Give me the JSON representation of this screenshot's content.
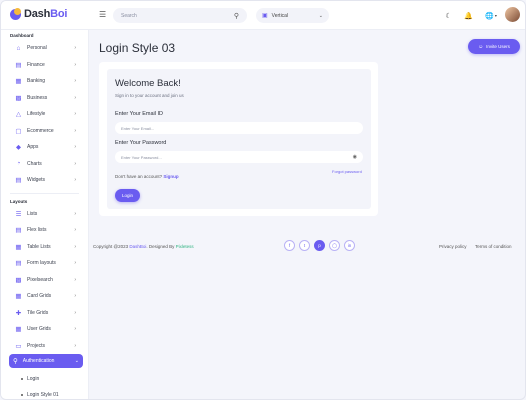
{
  "app": {
    "logo_prefix": "Dash",
    "logo_suffix": "Boi",
    "accent_color": "#6a5cf0"
  },
  "topbar": {
    "menu_icon": "hamburger-icon",
    "search_placeholder": "Search",
    "layout_value": "Vertical",
    "icons": [
      "moon-icon",
      "bell-icon",
      "globe-icon"
    ]
  },
  "sidebar": {
    "section_dashboard": "Dashboard",
    "dashboard_items": [
      {
        "label": "Personal",
        "icon": "home-icon"
      },
      {
        "label": "Finance",
        "icon": "finance-icon"
      },
      {
        "label": "Banking",
        "icon": "bank-icon"
      },
      {
        "label": "Business",
        "icon": "briefcase-icon"
      },
      {
        "label": "Lifestyle",
        "icon": "lifestyle-icon"
      },
      {
        "label": "Ecommerce",
        "icon": "cart-icon"
      },
      {
        "label": "Apps",
        "icon": "apps-icon"
      },
      {
        "label": "Charts",
        "icon": "chart-icon"
      },
      {
        "label": "Widgets",
        "icon": "widgets-icon"
      }
    ],
    "section_layouts": "Layouts",
    "layout_items": [
      {
        "label": "Lists",
        "icon": "list-icon"
      },
      {
        "label": "Flex lists",
        "icon": "flex-list-icon"
      },
      {
        "label": "Table Lists",
        "icon": "table-icon"
      },
      {
        "label": "Form layouts",
        "icon": "form-icon"
      },
      {
        "label": "Pixelsearch",
        "icon": "grid-search-icon"
      },
      {
        "label": "Card Grids",
        "icon": "card-grid-icon"
      },
      {
        "label": "Tile Grids",
        "icon": "tile-grid-icon"
      },
      {
        "label": "User Grids",
        "icon": "user-grid-icon"
      },
      {
        "label": "Projects",
        "icon": "folder-icon"
      }
    ],
    "active_item": {
      "label": "Authentication",
      "icon": "auth-icon"
    },
    "sub_items": [
      "Login",
      "Login Style 01"
    ]
  },
  "main": {
    "page_title": "Login Style 03",
    "invite_label": "Invite Users",
    "welcome": "Welcome Back!",
    "subtitle": "Sign in to your account and join us",
    "email_label": "Enter Your Email ID",
    "email_placeholder": "Enter Your Email...",
    "password_label": "Enter Your Password",
    "password_placeholder": "Enter Your Password...",
    "forgot": "Forgot password",
    "signup_text": "Don't have an account?",
    "signup_link": "Signup",
    "login_label": "Login"
  },
  "footer": {
    "copy_prefix": "Copyright @2023",
    "brand": "DashBoi",
    "designed_by": ". Designed By",
    "designer": "Pixletess",
    "socials": [
      "facebook-icon",
      "twitter-icon",
      "pinterest-icon",
      "instagram-icon",
      "linkedin-icon"
    ],
    "privacy": "Privacy policy",
    "terms": "Terms of condition"
  }
}
